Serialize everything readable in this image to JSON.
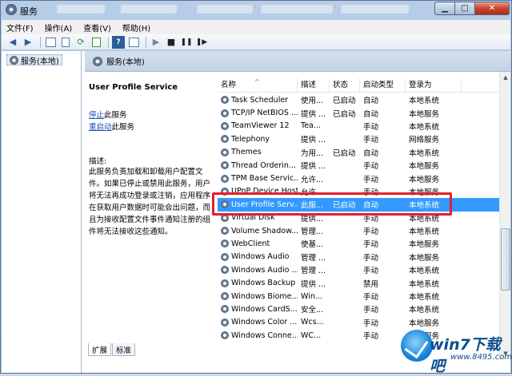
{
  "window": {
    "title": "服务"
  },
  "menu": [
    "文件(F)",
    "操作(A)",
    "查看(V)",
    "帮助(H)"
  ],
  "tree": {
    "root_label": "服务(本地)"
  },
  "pane_header": "服务(本地)",
  "detail": {
    "service_name": "User Profile Service",
    "stop_link": "停止",
    "stop_suffix": "此服务",
    "restart_link": "重启动",
    "restart_suffix": "此服务",
    "desc_label": "描述:",
    "desc_text": "此服务负责加载和卸载用户配置文件。如果已停止或禁用此服务，用户将无法再成功登录或注销，应用程序在获取用户数据时可能会出问题，而且为接收配置文件事件通知注册的组件将无法接收这些通知。"
  },
  "columns": [
    "名称",
    "描述",
    "状态",
    "启动类型",
    "登录为"
  ],
  "rows": [
    {
      "name": "Task Scheduler",
      "desc": "使用...",
      "status": "已启动",
      "start": "自动",
      "logon": "本地系统"
    },
    {
      "name": "TCP/IP NetBIOS ...",
      "desc": "提供 ...",
      "status": "已启动",
      "start": "自动",
      "logon": "本地服务"
    },
    {
      "name": "TeamViewer 12",
      "desc": "Tea...",
      "status": "",
      "start": "手动",
      "logon": "本地系统"
    },
    {
      "name": "Telephony",
      "desc": "提供 ...",
      "status": "",
      "start": "手动",
      "logon": "网络服务"
    },
    {
      "name": "Themes",
      "desc": "为用...",
      "status": "已启动",
      "start": "自动",
      "logon": "本地系统"
    },
    {
      "name": "Thread Orderin...",
      "desc": "提供 ...",
      "status": "",
      "start": "手动",
      "logon": "本地服务"
    },
    {
      "name": "TPM Base Servic...",
      "desc": "允许...",
      "status": "",
      "start": "手动",
      "logon": "本地服务"
    },
    {
      "name": "UPnP Device Host",
      "desc": "允许 ...",
      "status": "",
      "start": "手动",
      "logon": "本地服务"
    },
    {
      "name": "User Profile Serv...",
      "desc": "此服...",
      "status": "已启动",
      "start": "自动",
      "logon": "本地系统"
    },
    {
      "name": "Virtual Disk",
      "desc": "提供...",
      "status": "",
      "start": "手动",
      "logon": "本地系统"
    },
    {
      "name": "Volume Shadow...",
      "desc": "管理...",
      "status": "",
      "start": "手动",
      "logon": "本地系统"
    },
    {
      "name": "WebClient",
      "desc": "使基...",
      "status": "",
      "start": "手动",
      "logon": "本地服务"
    },
    {
      "name": "Windows Audio",
      "desc": "管理 ...",
      "status": "",
      "start": "手动",
      "logon": "本地服务"
    },
    {
      "name": "Windows Audio ...",
      "desc": "管理 ...",
      "status": "",
      "start": "手动",
      "logon": "本地系统"
    },
    {
      "name": "Windows Backup",
      "desc": "提供 ...",
      "status": "",
      "start": "禁用",
      "logon": "本地系统"
    },
    {
      "name": "Windows Biome...",
      "desc": "Win...",
      "status": "",
      "start": "手动",
      "logon": "本地系统"
    },
    {
      "name": "Windows CardS...",
      "desc": "安全...",
      "status": "",
      "start": "手动",
      "logon": "本地系统"
    },
    {
      "name": "Windows Color ...",
      "desc": "Wcs...",
      "status": "",
      "start": "手动",
      "logon": "本地服务"
    },
    {
      "name": "Windows Conne...",
      "desc": "WC...",
      "status": "",
      "start": "手动",
      "logon": "本地服务"
    }
  ],
  "selected_index": 8,
  "tabs": [
    "扩展",
    "标准"
  ],
  "watermark": {
    "brand": "win7下载吧",
    "url": "www.8495.com"
  }
}
